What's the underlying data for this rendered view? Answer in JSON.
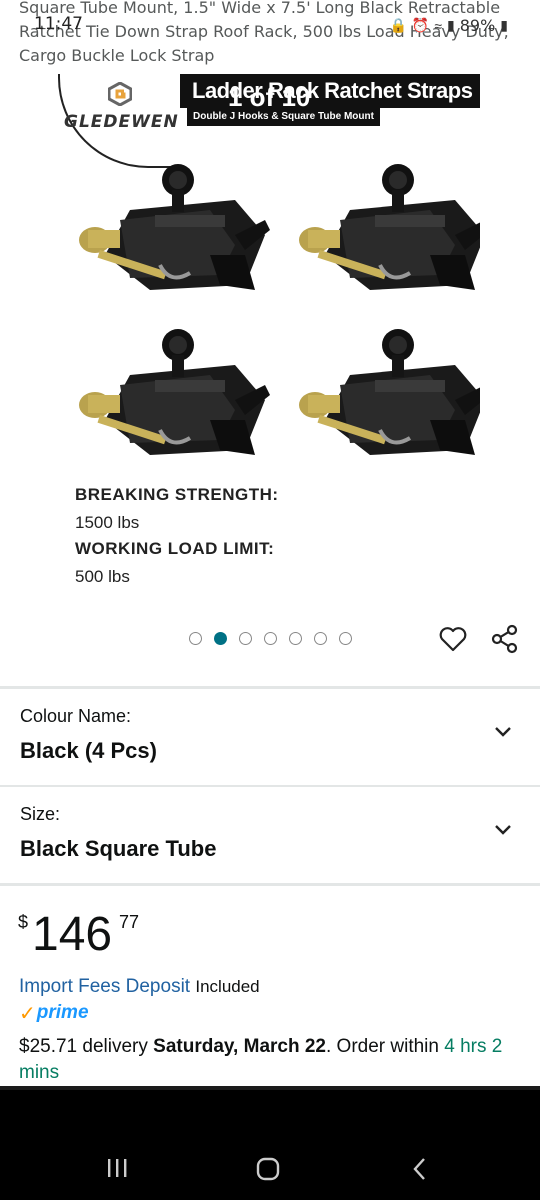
{
  "product": {
    "title": "Square Tube Mount, 1.5\" Wide x 7.5' Long Black Retractable Ratchet Tie Down Strap Roof Rack, 500 lbs Load Heavy Duty, Cargo Buckle Lock Strap"
  },
  "status_bar": {
    "time": "11:47",
    "battery": "89%"
  },
  "image": {
    "brand": "GLEDEWEN",
    "banner_title": "Ladder Rack Ratchet Straps",
    "banner_subtitle": "Double J Hooks & Square Tube Mount",
    "counter": "1 of 10",
    "spec1_label": "BREAKING STRENGTH:",
    "spec1_value": "1500 lbs",
    "spec2_label": "WORKING LOAD LIMIT:",
    "spec2_value": "500 lbs",
    "total_images": 7,
    "active_index": 1
  },
  "variations": {
    "colour_label": "Colour Name:",
    "colour_value": "Black (4 Pcs)",
    "size_label": "Size:",
    "size_value": "Black Square Tube"
  },
  "price": {
    "symbol": "$",
    "whole": "146",
    "fraction": "77"
  },
  "fees": {
    "link": "Import Fees Deposit",
    "included": "Included"
  },
  "prime": {
    "label": "prime"
  },
  "delivery": {
    "cost": "$25.71 delivery",
    "date": "Saturday, March 22",
    "order_prefix": ". Order within",
    "countdown": "4 hrs 2 mins"
  },
  "colors": {
    "link": "#2162a1",
    "prime": "#1a98ff",
    "check": "#ff9900",
    "green": "#067d62",
    "active_dot": "#007185"
  }
}
